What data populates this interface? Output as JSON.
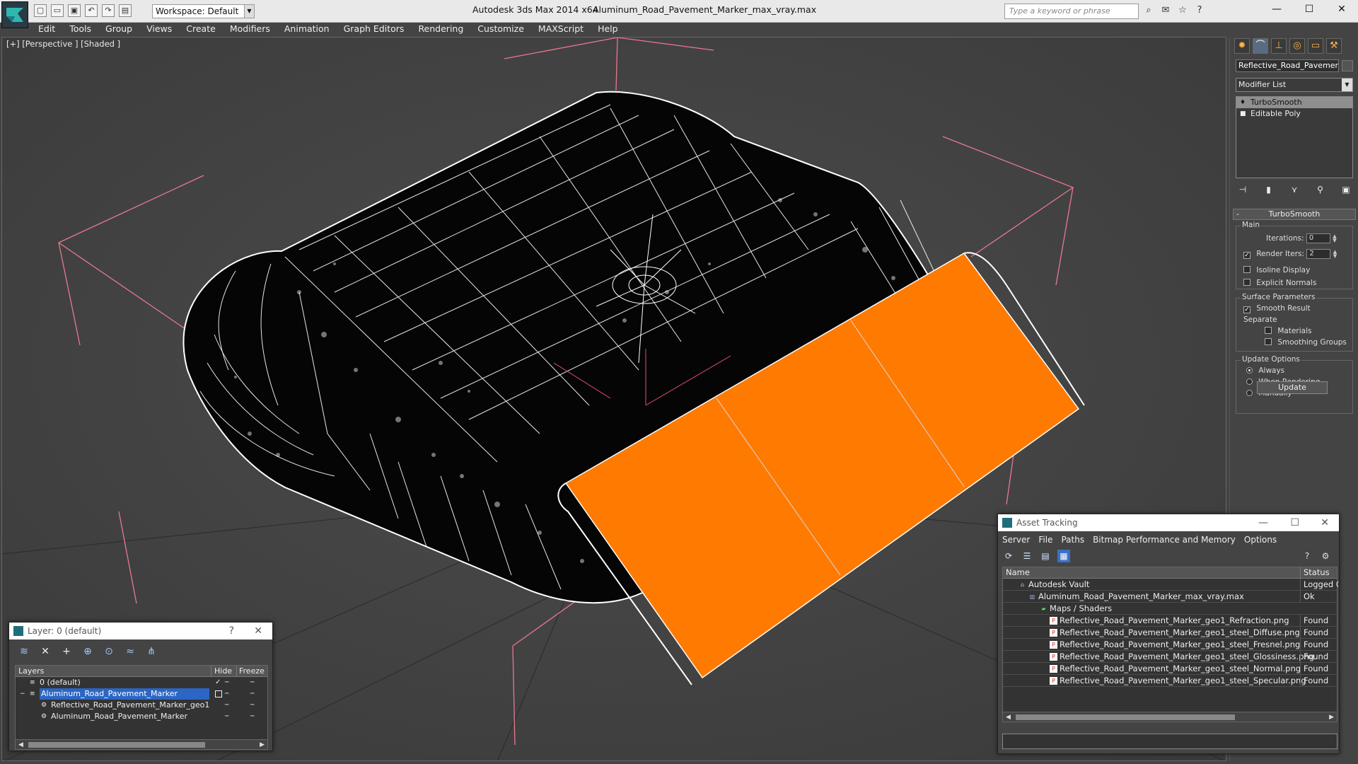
{
  "titlebar": {
    "app_title": "Autodesk 3ds Max  2014 x64",
    "file_title": "Aluminum_Road_Pavement_Marker_max_vray.max",
    "workspace": "Workspace: Default",
    "search_placeholder": "Type a keyword or phrase",
    "minimize": "—",
    "maximize": "☐",
    "close": "✕"
  },
  "menu": [
    "Edit",
    "Tools",
    "Group",
    "Views",
    "Create",
    "Modifiers",
    "Animation",
    "Graph Editors",
    "Rendering",
    "Customize",
    "MAXScript",
    "Help"
  ],
  "viewport": {
    "label": "[+] [Perspective ] [Shaded ]",
    "selection_color": "#ff7a00",
    "mesh_color": "#000000",
    "wire_color": "#ffffff",
    "bbox_color": "#e87890"
  },
  "command_panel": {
    "object_name": "Reflective_Road_Pavement_I",
    "modifier_list": "Modifier List",
    "stack": [
      "TurboSmooth",
      "Editable Poly"
    ],
    "rollout": {
      "title": "TurboSmooth",
      "main_label": "Main",
      "iterations_label": "Iterations:",
      "iterations_value": "0",
      "render_iters_label": "Render Iters:",
      "render_iters_value": "2",
      "render_iters_checked": true,
      "isoline_label": "Isoline Display",
      "explicit_label": "Explicit Normals",
      "surface_label": "Surface Parameters",
      "smooth_label": "Smooth Result",
      "separate_label": "Separate",
      "materials_label": "Materials",
      "smoothing_groups_label": "Smoothing Groups",
      "update_options_label": "Update Options",
      "always_label": "Always",
      "when_rendering_label": "When Rendering",
      "manually_label": "Manually",
      "update_button": "Update"
    }
  },
  "layer_window": {
    "title": "Layer: 0 (default)",
    "help": "?",
    "close": "✕",
    "columns": [
      "Layers",
      "Hide",
      "Freeze"
    ],
    "rows": [
      {
        "name": "0 (default)",
        "indent": 1,
        "selected": false
      },
      {
        "name": "Aluminum_Road_Pavement_Marker",
        "indent": 1,
        "selected": true
      },
      {
        "name": "Reflective_Road_Pavement_Marker_geo1",
        "indent": 2,
        "selected": false
      },
      {
        "name": "Aluminum_Road_Pavement_Marker",
        "indent": 2,
        "selected": false
      }
    ]
  },
  "asset_window": {
    "title": "Asset Tracking",
    "minimize": "—",
    "maximize": "☐",
    "close": "✕",
    "menu": [
      "Server",
      "File",
      "Paths",
      "Bitmap Performance and Memory",
      "Options"
    ],
    "columns": [
      "Name",
      "Status"
    ],
    "rows": [
      {
        "name": "Autodesk Vault",
        "status": "Logged O",
        "indent": 0,
        "icon": "vault"
      },
      {
        "name": "Aluminum_Road_Pavement_Marker_max_vray.max",
        "status": "Ok",
        "indent": 1,
        "icon": "max"
      },
      {
        "name": "Maps / Shaders",
        "status": "",
        "indent": 2,
        "icon": "folder"
      },
      {
        "name": "Reflective_Road_Pavement_Marker_geo1_Refraction.png",
        "status": "Found",
        "indent": 3,
        "icon": "png"
      },
      {
        "name": "Reflective_Road_Pavement_Marker_geo1_steel_Diffuse.png",
        "status": "Found",
        "indent": 3,
        "icon": "png"
      },
      {
        "name": "Reflective_Road_Pavement_Marker_geo1_steel_Fresnel.png",
        "status": "Found",
        "indent": 3,
        "icon": "png"
      },
      {
        "name": "Reflective_Road_Pavement_Marker_geo1_steel_Glossiness.png",
        "status": "Found",
        "indent": 3,
        "icon": "png"
      },
      {
        "name": "Reflective_Road_Pavement_Marker_geo1_steel_Normal.png",
        "status": "Found",
        "indent": 3,
        "icon": "png"
      },
      {
        "name": "Reflective_Road_Pavement_Marker_geo1_steel_Specular.png",
        "status": "Found",
        "indent": 3,
        "icon": "png"
      }
    ]
  }
}
